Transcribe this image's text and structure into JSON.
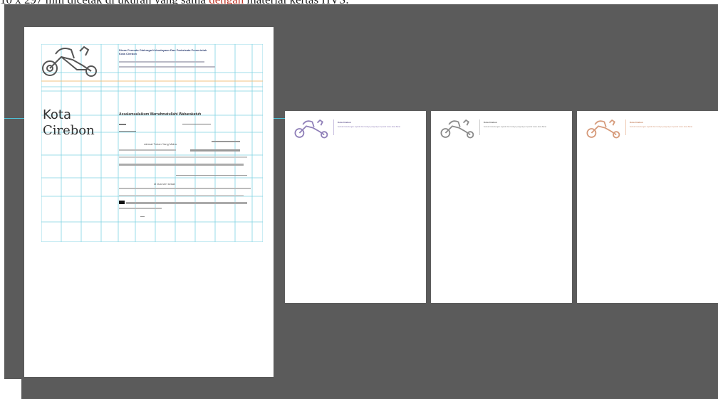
{
  "caption": {
    "before": "10 x 297 mm dicetak di ukuran yang sama ",
    "highlight": "dengan",
    "after": " material kertas HVS."
  },
  "main_page": {
    "org_name": "Dinas Pemuda Olahraga Kebudayaan Dan Pariwisata Pemerintah Kota Cirebon",
    "kota": "Kota",
    "cirebon": "Cirebon",
    "salam": "Assalamualaikum Warrahmatullahi Wabarakatuh",
    "line_tuhan": "rahmat Tuhan Yang Maha",
    "line_dua": "di dua seri sesan",
    "grid_color": "#7fd3e3",
    "accent_color": "#f0c080"
  },
  "thumbnails": [
    {
      "title": "Kota Cirebon",
      "body": "Sebuah kota dengan sejarah dan budaya yang kaya di pesisir utara Jawa Barat",
      "color": "#8f7fb8"
    },
    {
      "title": "Kota Cirebon",
      "body": "Sebuah kota dengan sejarah dan budaya yang kaya di pesisir utara Jawa Barat",
      "color": "#8a8a8a"
    },
    {
      "title": "Kota Cirebon",
      "body": "Sebuah kota dengan sejarah dan budaya yang kaya di pesisir utara Jawa Barat",
      "color": "#d69a7a"
    }
  ],
  "colors": {
    "canvas": "#5b5b5b",
    "guide": "#4fc3d9"
  }
}
